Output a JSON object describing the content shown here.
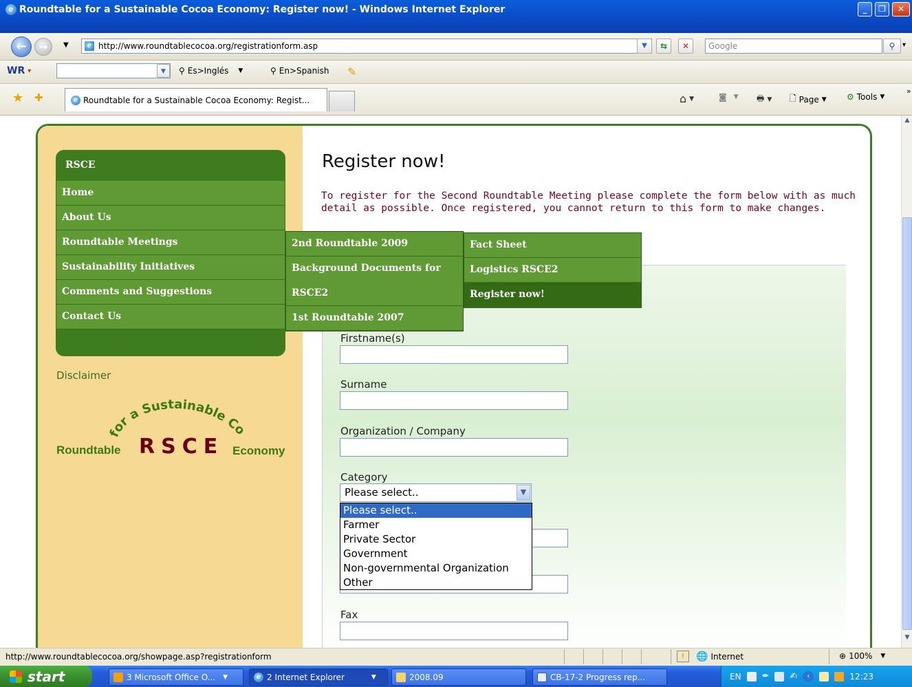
{
  "window": {
    "title": "Roundtable for a Sustainable Cocoa Economy: Register now! - Windows Internet Explorer"
  },
  "navbar": {
    "url": "http://www.roundtablecocoa.org/registrationform.asp",
    "search_placeholder": "Google"
  },
  "toolbar": {
    "wr_label": "WR",
    "es_ingles": "Es>Inglés",
    "en_spanish": "En>Spanish"
  },
  "tabs": {
    "active_label": "Roundtable for a Sustainable Cocoa Economy: Regist...",
    "page_label": "Page",
    "tools_label": "Tools"
  },
  "sidebar": {
    "menu_title": "RSCE",
    "items": [
      {
        "label": "Home"
      },
      {
        "label": "About Us"
      },
      {
        "label": "Roundtable Meetings"
      },
      {
        "label": "Sustainability Initiatives"
      },
      {
        "label": "Comments and Suggestions"
      },
      {
        "label": "Contact Us"
      }
    ],
    "disclaimer": "Disclaimer"
  },
  "submenu_meetings": {
    "items": [
      {
        "label": "2nd Roundtable 2009"
      },
      {
        "label": "Background Documents for"
      },
      {
        "label": "RSCE2"
      },
      {
        "label": "1st Roundtable 2007"
      }
    ]
  },
  "submenu_2nd": {
    "items": [
      {
        "label": "Fact Sheet"
      },
      {
        "label": "Logistics RSCE2"
      },
      {
        "label": "Register now!"
      }
    ]
  },
  "logo": {
    "arc_text": "for a Sustainable Cocoa",
    "left": "Roundtable",
    "center": "RSCE",
    "right": "Economy"
  },
  "main": {
    "heading": "Register now!",
    "intro_line1": "To register for the Second Roundtable Meeting please complete the form below with as much",
    "intro_line2": "detail as possible. Once registered, you cannot return to this form to make changes.",
    "fields": {
      "firstname": "Firstname(s)",
      "surname": "Surname",
      "organization": "Organization / Company",
      "category": "Category",
      "fax": "Fax"
    },
    "category_selected": "Please select..",
    "category_options": [
      "Please select..",
      "Farmer",
      "Private Sector",
      "Government",
      "Non-governmental Organization",
      "Other"
    ]
  },
  "statusbar": {
    "url": "http://www.roundtablecocoa.org/showpage.asp?registrationform",
    "zone": "Internet",
    "zoom": "100%"
  },
  "taskbar": {
    "start": "start",
    "buttons": [
      {
        "label": "3 Microsoft Office O..."
      },
      {
        "label": "2 Internet Explorer"
      },
      {
        "label": "2008.09"
      },
      {
        "label": "CB-17-2 Progress rep..."
      }
    ],
    "lang": "EN",
    "time": "12:23"
  }
}
